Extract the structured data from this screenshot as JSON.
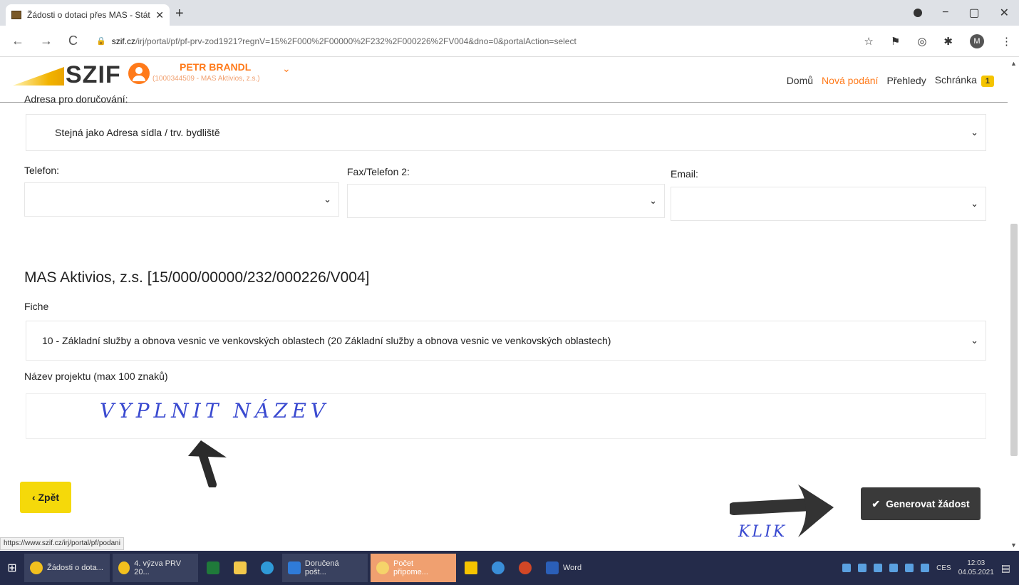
{
  "browser": {
    "tab_title": "Žádosti o dotaci přes MAS - Stát",
    "url_host": "szif.cz",
    "url_path": "/irj/portal/pf/pf-prv-zod1921?regnV=15%2F000%2F00000%2F232%2F000226%2FV004&dno=0&portalAction=select",
    "avatar_letter": "M",
    "status_url": "https://www.szif.cz/irj/portal/pf/podani"
  },
  "header": {
    "logo": "SZIF",
    "user_name": "PETR BRANDL",
    "user_sub": "(1000344509 - MAS Aktivios, z.s.)",
    "nav": [
      "Domů",
      "Nová podání",
      "Přehledy",
      "Schránka"
    ],
    "inbox_count": "1",
    "active_nav": "Nová podání"
  },
  "form": {
    "delivery_label": "Adresa pro doručování:",
    "delivery_value": "Stejná jako Adresa sídla / trv. bydliště",
    "phone_label": "Telefon:",
    "fax_label": "Fax/Telefon 2:",
    "email_label": "Email:",
    "section_title": "MAS Aktivios, z.s. [15/000/00000/232/000226/V004]",
    "fiche_label": "Fiche",
    "fiche_value": "10 - Základní služby a obnova vesnic ve venkovských oblastech (20 Základní služby a obnova vesnic ve venkovských oblastech)",
    "project_name_label": "Název projektu (max 100 znaků)"
  },
  "annotations": {
    "fill_name": "VYPLNIT NÁZEV",
    "click": "KLIK"
  },
  "buttons": {
    "back": "‹ Zpět",
    "generate": "Generovat žádost"
  },
  "taskbar": {
    "items": [
      "Žádosti o dota...",
      "4. výzva PRV 20...",
      "Doručená pošt...",
      "Počet připome...",
      "Word"
    ],
    "lang": "CES",
    "time": "12:03",
    "date": "04.05.2021"
  }
}
